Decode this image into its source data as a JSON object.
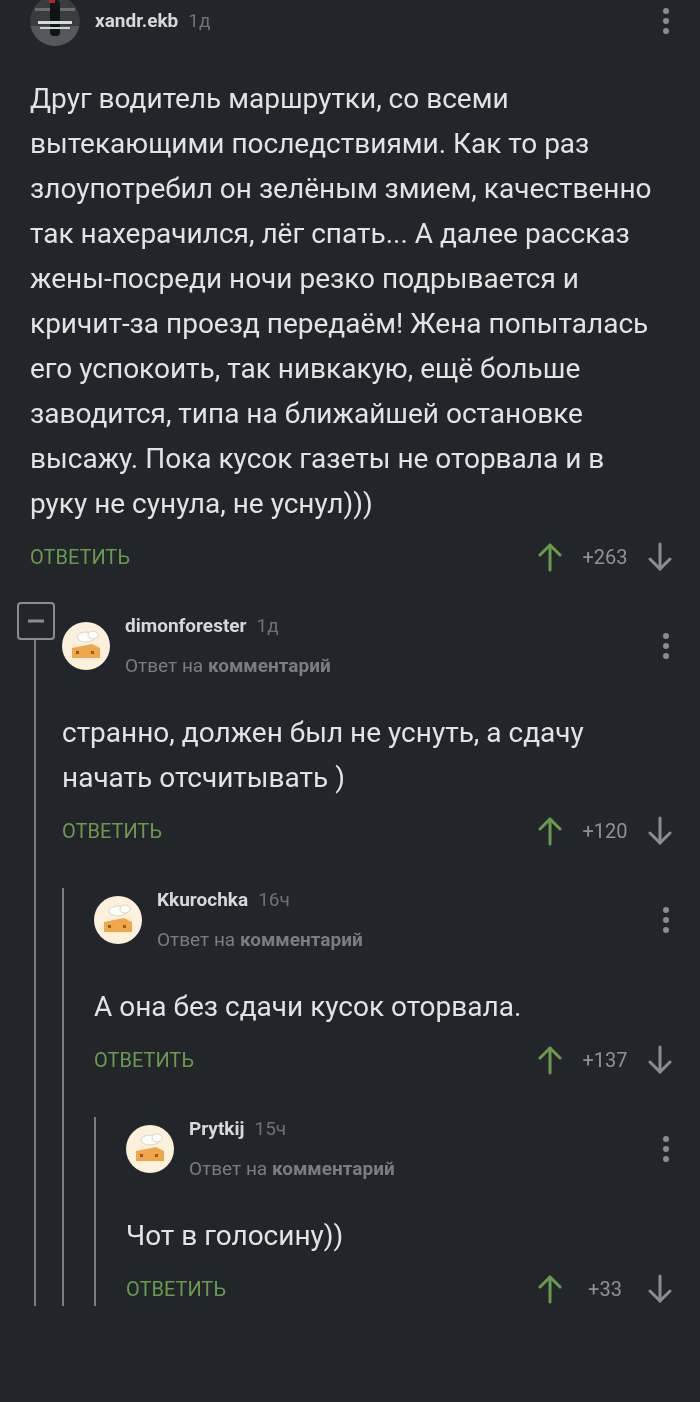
{
  "comments": [
    {
      "author": "xandr.ekb",
      "time": "1д",
      "text": "Друг водитель маршрутки, со всеми вытекающими последствиями. Как то раз злоупотребил он зелёным змием, качественно так нахерачился, лёг спать... А далее рассказ жены-посреди ночи резко подрывается и кричит-за проезд передаём! Жена попыталась его успокоить, так нивкакую, ещё больше заводится, типа на ближайшей остановке высажу. Пока кусок газеты не оторвала и в руку не сунула, не уснул)))",
      "reply_label": "ОТВЕТИТЬ",
      "score": "+263",
      "thread_expanded": true,
      "children": [
        {
          "author": "dimonforester",
          "time": "1д",
          "avatar": {
            "kind": "drawing"
          },
          "reply_to": "Ответ на **комментарий**",
          "text": "странно, должен был не уснуть, а сдачу начать отсчитывать )",
          "reply_label": "ОТВЕТИТЬ",
          "score": "+120",
          "children": [
            {
              "author": "Kkurochka",
              "time": "16ч",
              "avatar": {
                "kind": "drawing"
              },
              "reply_to": "Ответ на **комментарий**",
              "text": "А она без сдачи кусок оторвала.",
              "reply_label": "ОТВЕТИТЬ",
              "score": "+137",
              "children": [
                {
                  "author": "Prytkij",
                  "time": "15ч",
                  "avatar": {
                    "kind": "drawing"
                  },
                  "reply_to": "Ответ на **комментарий**",
                  "text": "Чот в голосину))",
                  "reply_label": "ОТВЕТИТЬ",
                  "score": "+33"
                }
              ]
            }
          ]
        }
      ]
    }
  ]
}
